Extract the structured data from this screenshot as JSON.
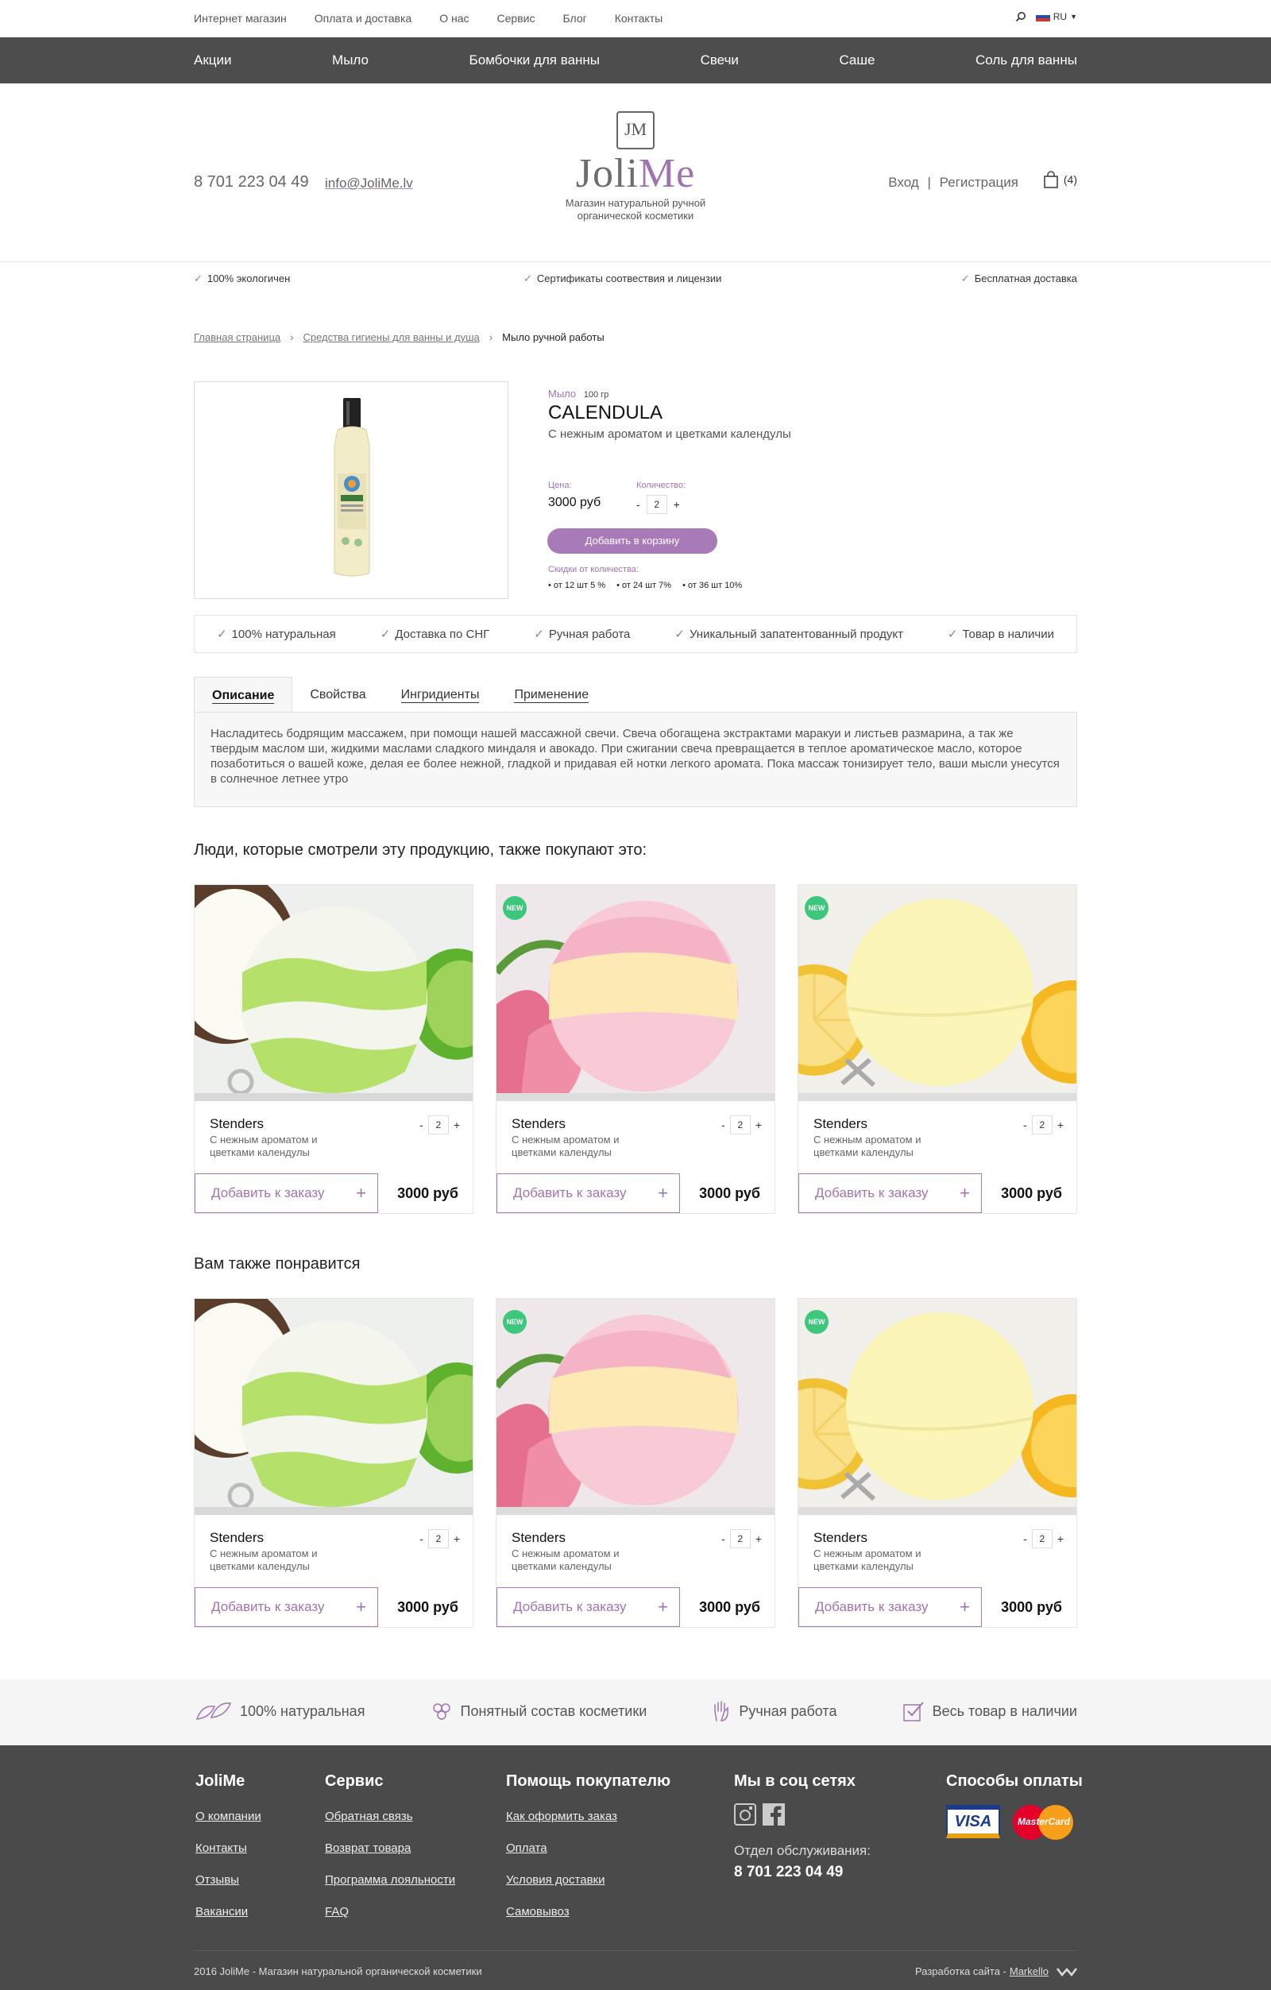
{
  "topbar": {
    "links": [
      "Интернет магазин",
      "Оплата и доставка",
      "О нас",
      "Сервис",
      "Блог",
      "Контакты"
    ],
    "lang": "RU"
  },
  "nav": [
    "Акции",
    "Мыло",
    "Бомбочки для ванны",
    "Свечи",
    "Саше",
    "Соль для ванны"
  ],
  "header": {
    "phone": "8 701 223 04 49",
    "email": "info@JoliMe.lv",
    "logo_monogram": "JM",
    "logo_name_a": "Joli",
    "logo_name_b": "Me",
    "tagline_1": "Магазин натуральной ручной",
    "tagline_2": "органической косметики",
    "login": "Вход",
    "register": "Регистрация",
    "cart_count": "(4)"
  },
  "features": [
    "100% экологичен",
    "Сертификаты соотвествия и лицензии",
    "Бесплатная доставка"
  ],
  "breadcrumb": [
    "Главная страница",
    "Средства гигиены для ванны и душа",
    "Мыло ручной работы"
  ],
  "product": {
    "category": "Мыло",
    "weight": "100 гр",
    "name": "CALENDULA",
    "subtitle": "С нежным ароматом и цветками календулы",
    "price_label": "Цена:",
    "price": "3000 руб",
    "qty_label": "Количество:",
    "qty": "2",
    "add_button": "Добавить в корзину",
    "discount_label": "Скидки от количества:",
    "discounts": [
      "от 12 шт 5 %",
      "от 24 шт 7%",
      "от 36 шт 10%"
    ]
  },
  "badges": [
    "100% натуральная",
    "Доставка по СНГ",
    "Ручная работа",
    "Уникальный запатентованный продукт",
    "Товар в наличии"
  ],
  "tabs": [
    "Описание",
    "Свойства",
    "Ингридиенты",
    "Применение"
  ],
  "description": "Насладитесь бодрящим массажем, при помощи нашей массажной свечи. Свеча обогащена экстрактами маракуи и листьев размарина, а так же твердым маслом ши, жидкими маслами сладкого миндаля и авокадо. При сжигании свеча превращается в теплое ароматическое масло, которое позаботиться о вашей коже, делая ее более нежной, гладкой и придавая ей нотки легкого аромата. Пока массаж тонизирует тело, ваши мысли унесутся в солнечное летнее утро",
  "section_also_bought": "Люди, которые смотрели эту продукцию, также покупают это:",
  "section_you_like": "Вам также понравится",
  "card": {
    "title": "Stenders",
    "subtitle": "С нежным ароматом и цветками календулы",
    "qty": "2",
    "add": "Добавить к заказу",
    "price": "3000 руб",
    "new_badge": "NEW"
  },
  "benefits": [
    "100% натуральная",
    "Понятный состав косметики",
    "Ручная работа",
    "Весь товар в наличии"
  ],
  "footer": {
    "col1_title": "JoliMe",
    "col1": [
      "О компании",
      "Контакты",
      "Отзывы",
      "Вакансии"
    ],
    "col2_title": "Сервис",
    "col2": [
      "Обратная связь",
      "Возврат товара",
      "Программа лояльности",
      "FAQ"
    ],
    "col3_title": "Помощь покупателю",
    "col3": [
      "Как оформить заказ",
      "Оплата",
      "Условия доставки",
      "Самовывоз"
    ],
    "col4_title": "Мы в соц сетях",
    "service_label": "Отдел обслуживания:",
    "service_phone": "8 701 223 04 49",
    "col5_title": "Способы оплаты",
    "visa": "VISA",
    "mastercard": "MasterCard",
    "copyright": "2016 JoliMe - Магазин натуральной органической косметики",
    "dev_label": "Разработка сайта - ",
    "dev_name": "Markello"
  },
  "colors": {
    "accent": "#a273b1",
    "nav_bg": "#4d4d4d",
    "footer_bg": "#4a4a4a",
    "new_badge": "#3cc77c"
  }
}
